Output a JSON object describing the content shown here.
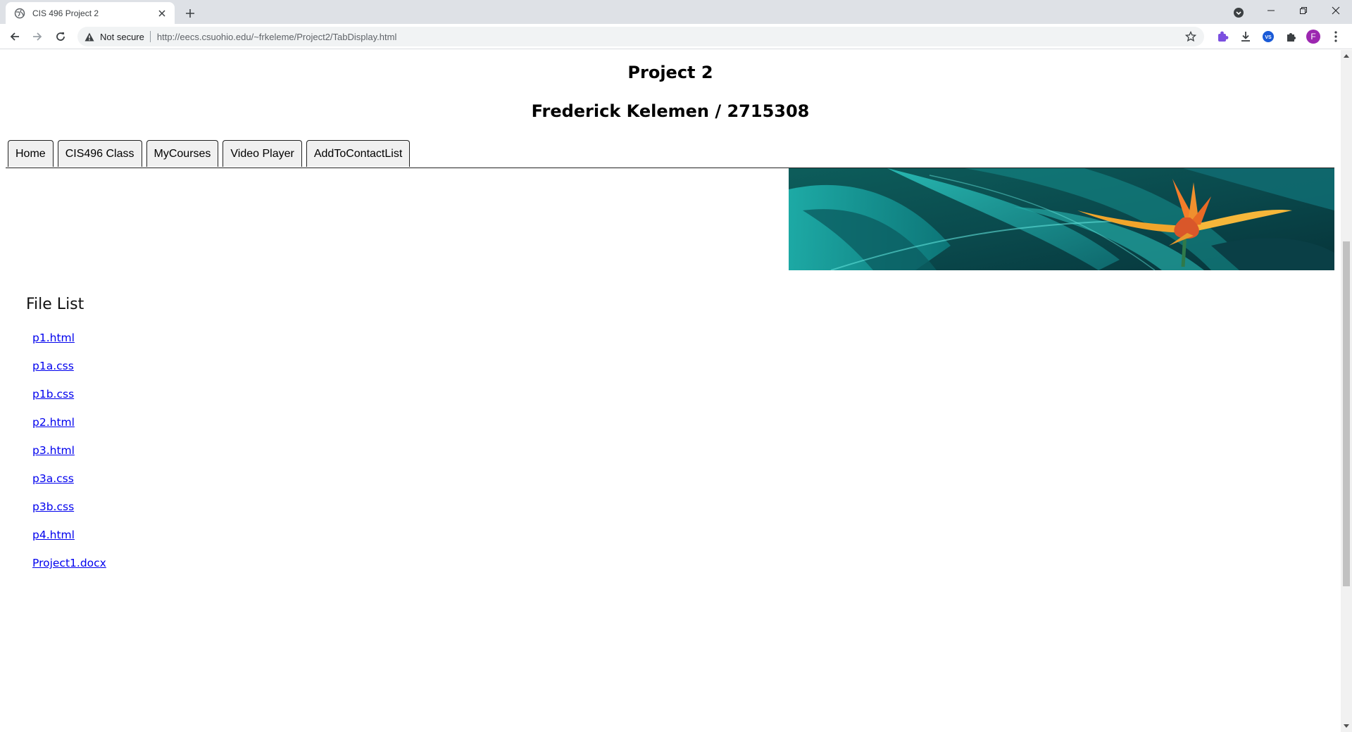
{
  "browser": {
    "tab_title": "CIS 496 Project 2",
    "security_label": "Not secure",
    "url": "http://eecs.csuohio.edu/~frkeleme/Project2/TabDisplay.html",
    "profile_initial": "F",
    "accent_profile_color": "#9c27b0"
  },
  "page": {
    "title": "Project 2",
    "subtitle": "Frederick Kelemen / 2715308",
    "tabs": [
      {
        "label": "Home"
      },
      {
        "label": "CIS496 Class"
      },
      {
        "label": "MyCourses"
      },
      {
        "label": "Video Player"
      },
      {
        "label": "AddToContactList"
      }
    ],
    "file_list_title": "File List",
    "files": [
      {
        "name": "p1.html"
      },
      {
        "name": "p1a.css"
      },
      {
        "name": "p1b.css"
      },
      {
        "name": "p2.html"
      },
      {
        "name": "p3.html"
      },
      {
        "name": "p3a.css"
      },
      {
        "name": "p3b.css"
      },
      {
        "name": "p4.html"
      },
      {
        "name": "Project1.docx"
      }
    ]
  }
}
